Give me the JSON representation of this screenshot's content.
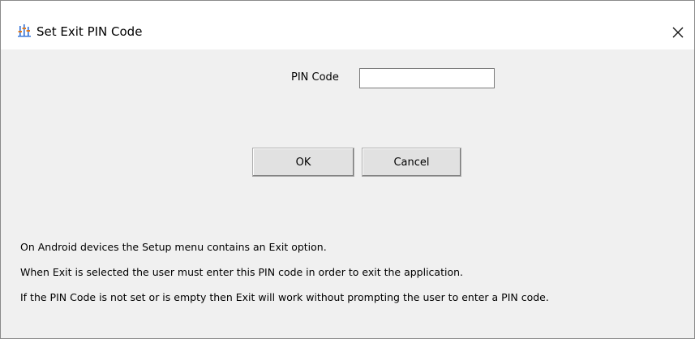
{
  "window": {
    "title": "Set Exit PIN Code",
    "close_glyph": "✕",
    "icon": "settings-sliders-icon"
  },
  "form": {
    "pin_label": "PIN Code",
    "pin_value": "",
    "pin_placeholder": ""
  },
  "buttons": {
    "ok_label": "OK",
    "cancel_label": "Cancel"
  },
  "description": {
    "line1": "On Android devices the Setup menu contains an Exit option.",
    "line2": "When Exit is selected the user must enter this PIN code in order to exit the application.",
    "line3": "If the PIN Code is not set or is empty then Exit will work without prompting the user to enter a PIN code."
  },
  "colors": {
    "icon_blue": "#2f6fd6",
    "icon_orange": "#e07a1f",
    "dialog_background": "#f0f0f0",
    "titlebar_background": "#ffffff"
  }
}
